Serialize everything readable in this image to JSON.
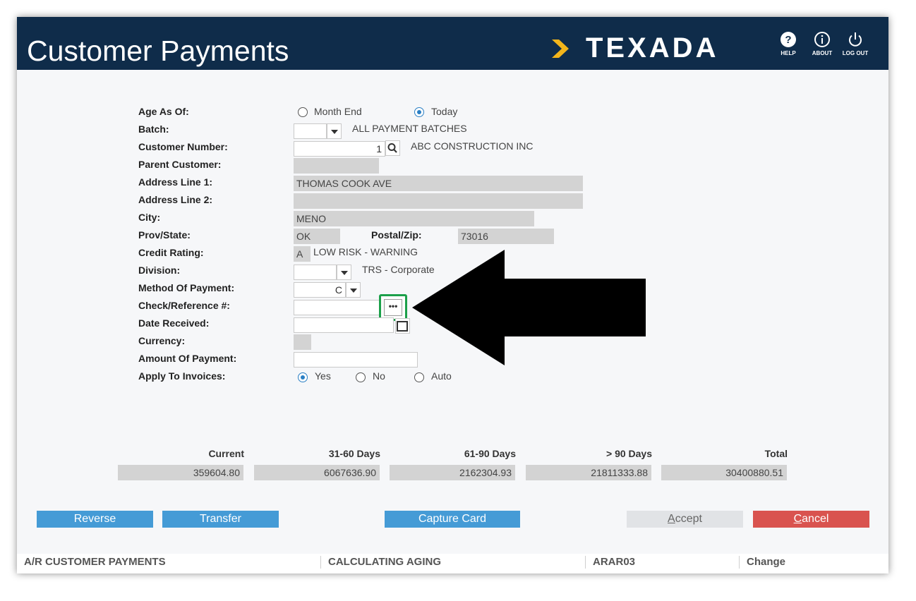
{
  "app": {
    "title": "Customer Payments"
  },
  "brand": {
    "logo_text": "TEXADA",
    "colors": {
      "header": "#0f2c4a",
      "accent": "#459bd6",
      "danger": "#d9534f",
      "highlight": "#1ca04a"
    }
  },
  "header_icons": [
    {
      "icon": "help-icon",
      "label": "HELP"
    },
    {
      "icon": "about-icon",
      "label": "ABOUT"
    },
    {
      "icon": "power-icon",
      "label": "LOG OUT"
    }
  ],
  "form": {
    "age_as_of": {
      "label": "Age As Of:",
      "options": [
        "Month End",
        "Today"
      ],
      "selected": "Today"
    },
    "batch": {
      "label": "Batch:",
      "value": "",
      "description": "ALL PAYMENT BATCHES"
    },
    "customer_number": {
      "label": "Customer Number:",
      "value": "1",
      "description": "ABC CONSTRUCTION INC"
    },
    "parent_customer": {
      "label": "Parent Customer:",
      "value": ""
    },
    "address_line_1": {
      "label": "Address Line 1:",
      "value": "THOMAS COOK AVE"
    },
    "address_line_2": {
      "label": "Address Line 2:",
      "value": ""
    },
    "city": {
      "label": "City:",
      "value": "MENO"
    },
    "prov_state": {
      "label": "Prov/State:",
      "value": "OK"
    },
    "postal_zip": {
      "label": "Postal/Zip:",
      "value": "73016"
    },
    "credit_rating": {
      "label": "Credit Rating:",
      "value": "A",
      "description": "LOW RISK - WARNING"
    },
    "division": {
      "label": "Division:",
      "value": "",
      "description": "TRS - Corporate"
    },
    "method_of_payment": {
      "label": "Method Of Payment:",
      "value": "C"
    },
    "check_reference": {
      "label": "Check/Reference #:",
      "value": "",
      "button_glyph": "•••"
    },
    "date_received": {
      "label": "Date Received:",
      "value": ""
    },
    "currency": {
      "label": "Currency:",
      "value": ""
    },
    "amount_of_payment": {
      "label": "Amount Of Payment:",
      "value": ""
    },
    "apply_to_invoices": {
      "label": "Apply To Invoices:",
      "options": [
        "Yes",
        "No",
        "Auto"
      ],
      "selected": "Yes"
    }
  },
  "aging": {
    "headers": [
      "Current",
      "31-60 Days",
      "61-90 Days",
      "> 90 Days",
      "Total"
    ],
    "values": [
      "359604.80",
      "6067636.90",
      "2162304.93",
      "21811333.88",
      "30400880.51"
    ]
  },
  "buttons": {
    "reverse": "Reverse",
    "transfer": "Transfer",
    "capture_card": "Capture Card",
    "accept_rest": "ccept",
    "accept_mnemonic": "A",
    "cancel_rest": "ancel",
    "cancel_mnemonic": "C"
  },
  "status_bar": {
    "module": "A/R CUSTOMER PAYMENTS",
    "process": "CALCULATING AGING",
    "program": "ARAR03",
    "mode": "Change"
  }
}
